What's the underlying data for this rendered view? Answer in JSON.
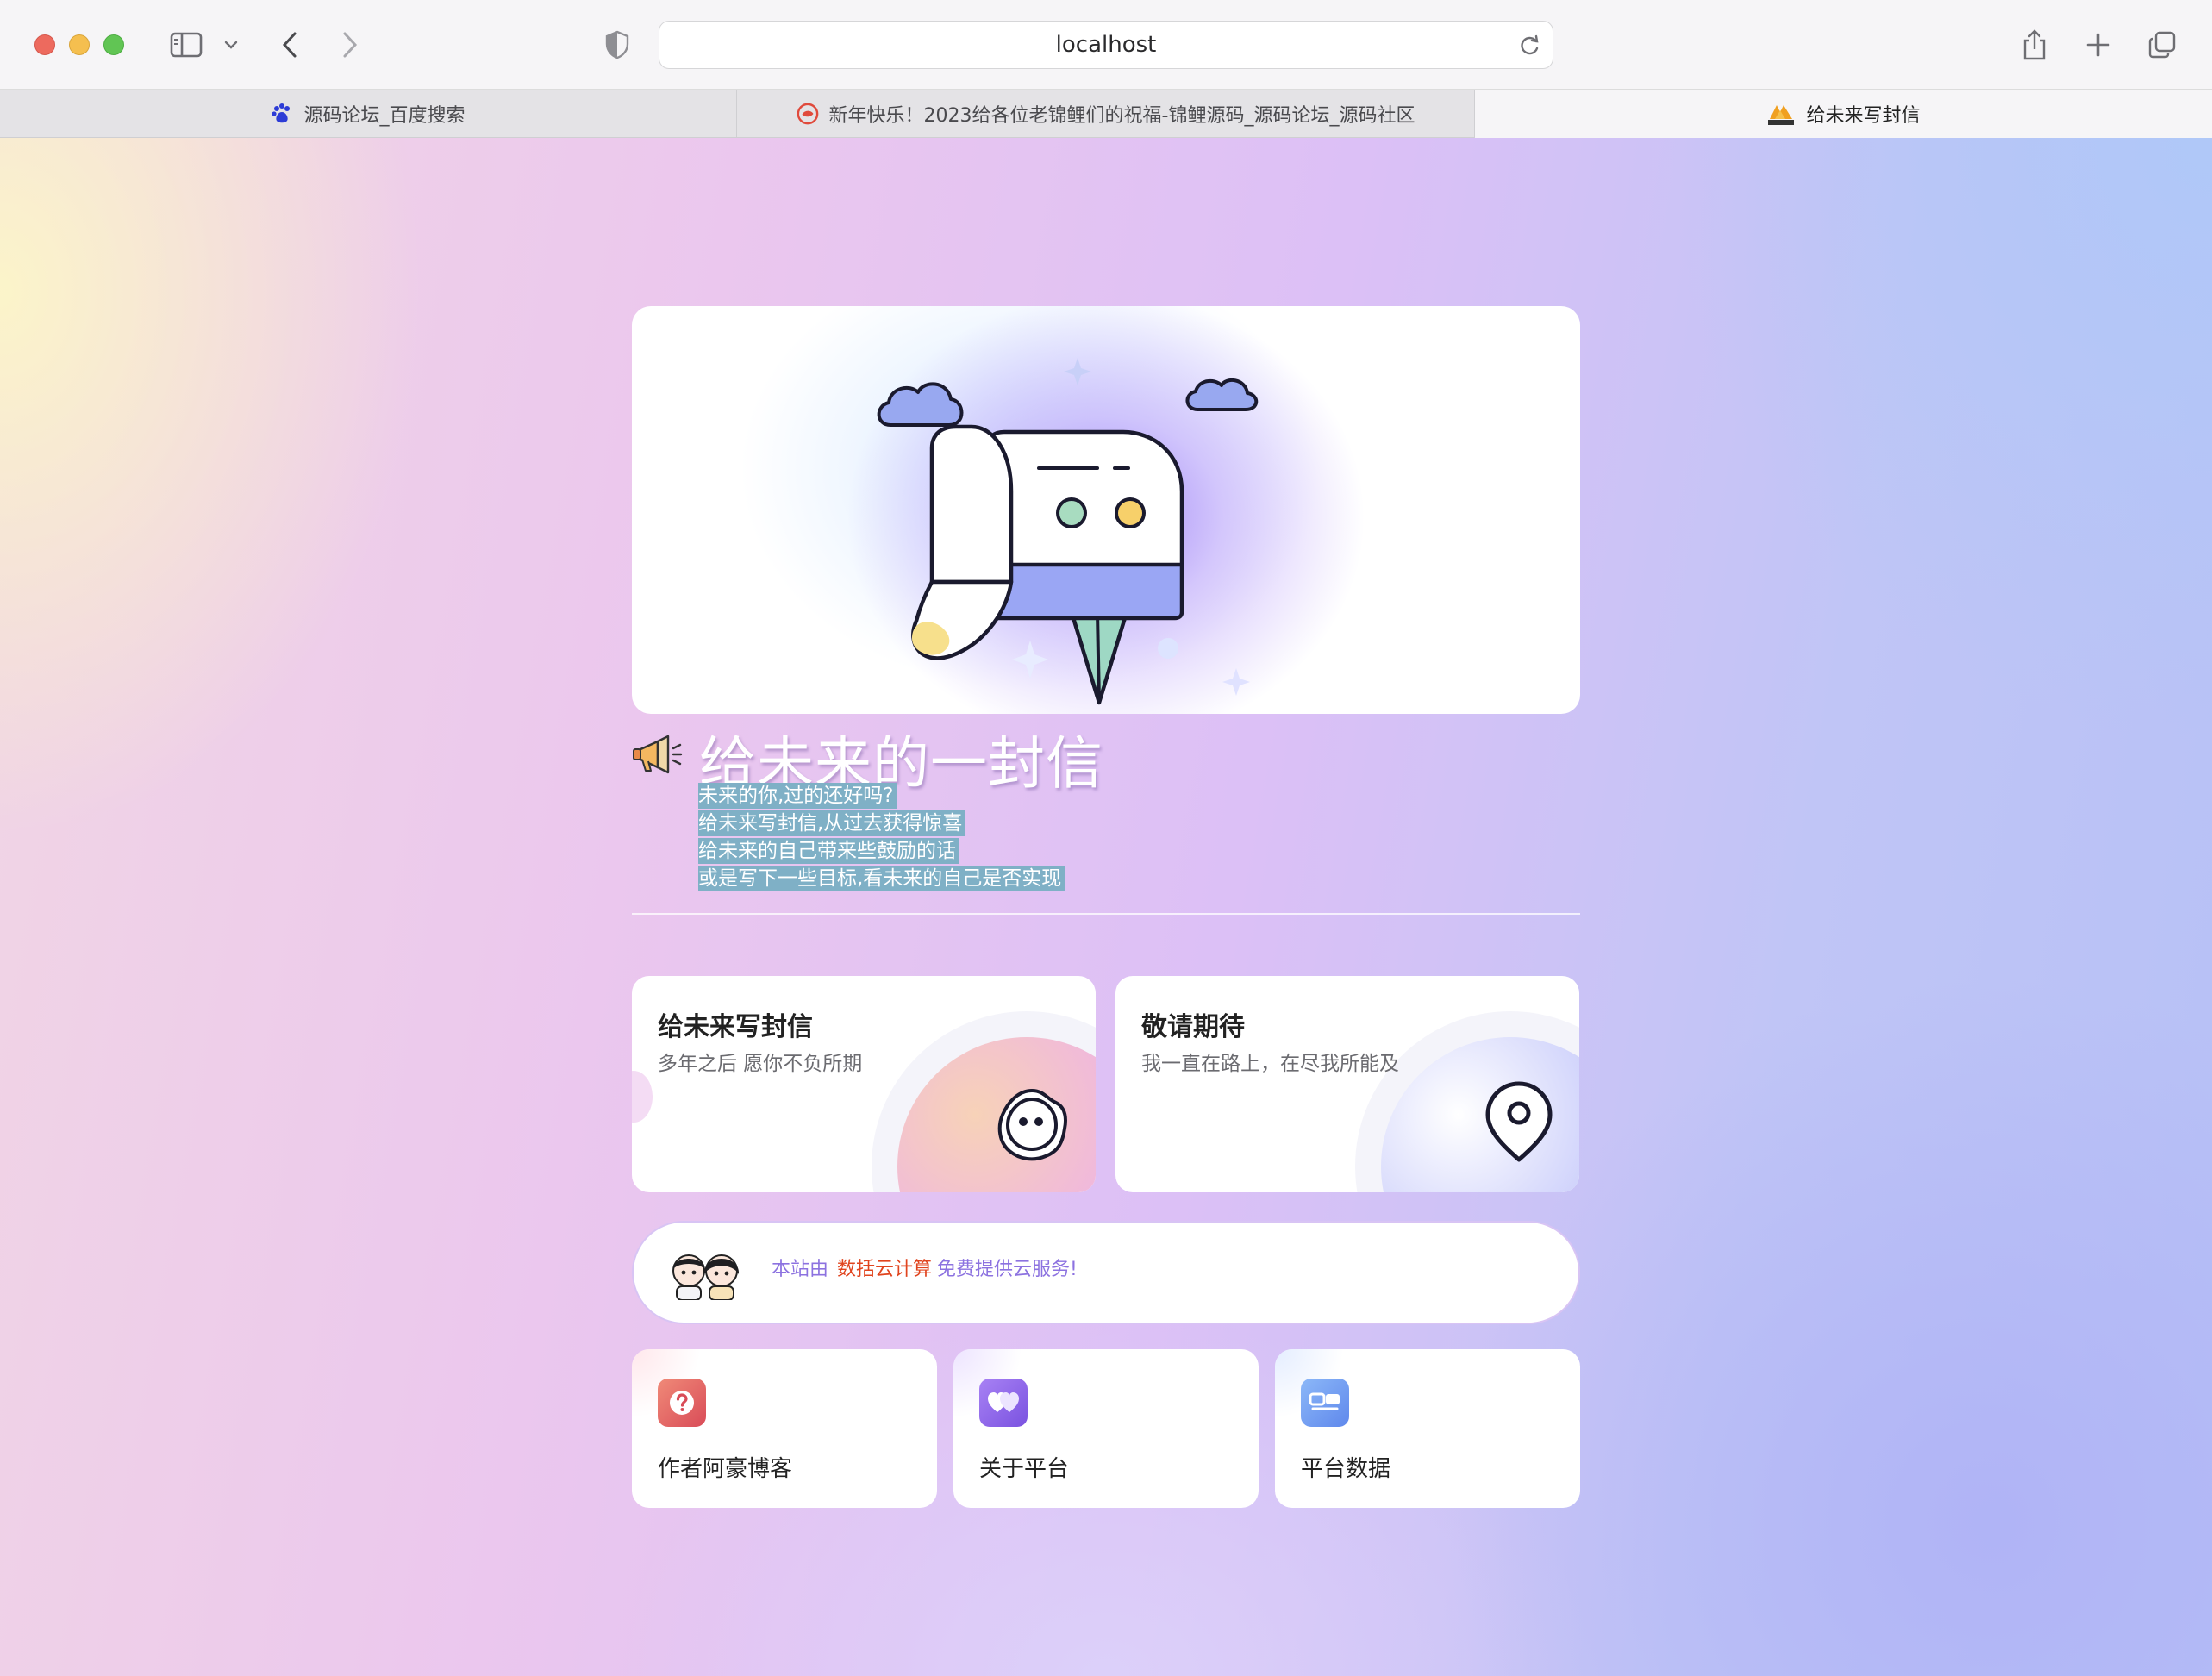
{
  "browser": {
    "url": "localhost",
    "tabs": [
      {
        "title": "源码论坛_百度搜索",
        "icon": "baidu-paw-icon",
        "active": false
      },
      {
        "title": "新年快乐！2023给各位老锦鲤们的祝福-锦鲤源码_源码论坛_源码社区",
        "icon": "koi-logo-icon",
        "active": false
      },
      {
        "title": "给未来写封信",
        "icon": "pma-logo-icon",
        "active": true
      }
    ]
  },
  "page": {
    "title": "给未来的一封信",
    "intro": [
      "未来的你,过的还好吗?",
      "给未来写封信,从过去获得惊喜",
      "给未来的自己带来些鼓励的话",
      "或是写下一些目标,看未来的自己是否实现"
    ],
    "cards": [
      {
        "title": "给未来写封信",
        "subtitle": "多年之后 愿你不负所期",
        "icon": "face-bubble-icon"
      },
      {
        "title": "敬请期待",
        "subtitle": "我一直在路上，在尽我所能及",
        "icon": "location-pin-icon"
      }
    ],
    "sponsor": {
      "prefix": "本站由",
      "highlight": "数括云计算",
      "suffix": "免费提供云服务!"
    },
    "tiles": [
      {
        "label": "作者阿豪博客",
        "icon": "question-icon",
        "color": "#e2605e"
      },
      {
        "label": "关于平台",
        "icon": "hearts-icon",
        "color": "#8a63e8"
      },
      {
        "label": "平台数据",
        "icon": "data-icon",
        "color": "#6f9ef0"
      }
    ]
  },
  "colors": {
    "accent": "#8c72e0",
    "highlight": "#e0441e",
    "intro_highlight_bg": "#7fb0c6"
  }
}
